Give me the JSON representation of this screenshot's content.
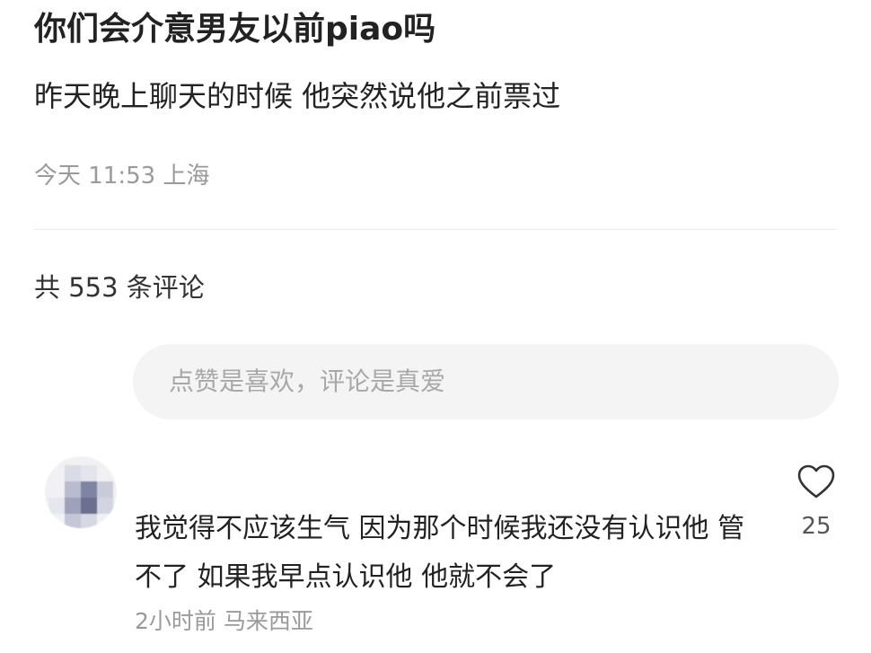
{
  "post": {
    "title": "你们会介意男友以前piao吗",
    "body": "昨天晚上聊天的时候  他突然说他之前票过",
    "meta": "今天 11:53 上海"
  },
  "comments": {
    "count_label": "共 553 条评论",
    "input_placeholder": "点赞是喜欢，评论是真爱",
    "items": [
      {
        "text": "我觉得不应该生气 因为那个时候我还没有认识他 管不了 如果我早点认识他 他就不会了",
        "meta": "2小时前 马来西亚",
        "likes": "25",
        "like_icon": "heart-icon",
        "avatar": "blurred-avatar"
      }
    ]
  }
}
